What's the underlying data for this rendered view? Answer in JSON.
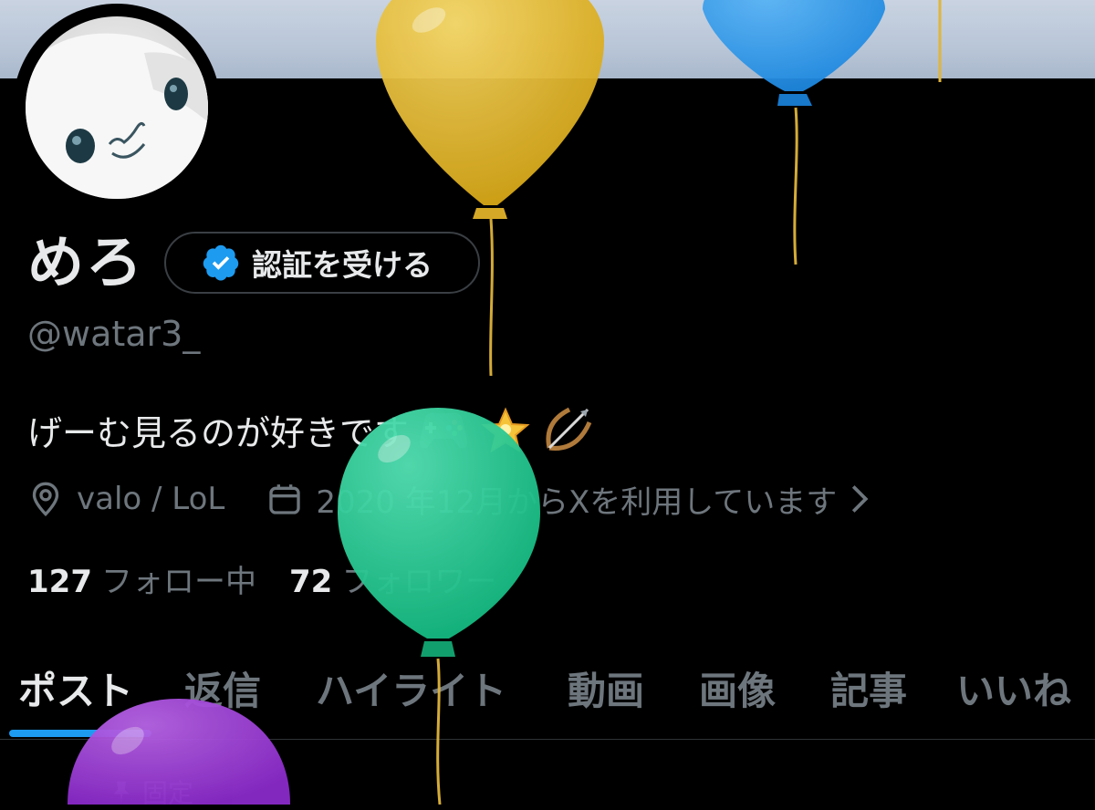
{
  "profile": {
    "display_name": "めろ",
    "verify_button_label": "認証を受ける",
    "handle": "@watar3_",
    "bio": "げーむ見るのが好きです",
    "bio_emojis": [
      "game-controller-icon",
      "glowing-star-icon",
      "bow-and-arrow-icon"
    ],
    "location": "valo / LoL",
    "joined": "2020 年12月からXを利用しています",
    "following_count": "127",
    "following_label": "フォロー中",
    "followers_count": "72",
    "followers_label": "フォロワー"
  },
  "tabs": [
    {
      "label": "ポスト",
      "active": true
    },
    {
      "label": "返信",
      "active": false
    },
    {
      "label": "ハイライト",
      "active": false
    },
    {
      "label": "動画",
      "active": false
    },
    {
      "label": "画像",
      "active": false
    },
    {
      "label": "記事",
      "active": false
    },
    {
      "label": "いいね",
      "active": false
    }
  ],
  "pinned_label": "固定",
  "colors": {
    "accent": "#1d9bf0",
    "muted_text": "#6e767d",
    "primary_text": "#e7e9ea",
    "background": "#000000",
    "balloon_yellow": "#e8bd24",
    "balloon_blue": "#2e9bf0",
    "balloon_green": "#22d49a",
    "balloon_purple": "#9a3ad6"
  }
}
